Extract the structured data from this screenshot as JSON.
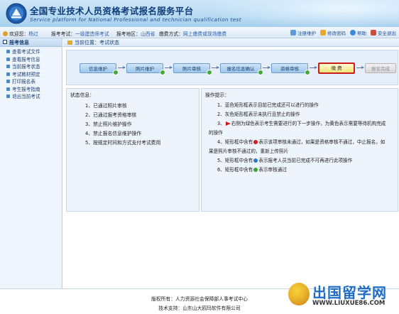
{
  "header": {
    "title": "全国专业技术人员资格考试报名服务平台",
    "subtitle": "Service platform for National Professional and technician qualification test"
  },
  "infobar": {
    "welcome_label": "欢迎您：",
    "welcome_user": "杨过",
    "exam_label": "报考考试：",
    "exam_value": "一级建造师考试",
    "region_label": "报考地区：",
    "region_value": "山西省",
    "fee_label": "缴费方式：",
    "fee_value": "网上缴费或现场缴费",
    "links": [
      "注册维护",
      "修改密码",
      "帮助",
      "安全退出"
    ]
  },
  "sidebar": {
    "title": "报考信息",
    "items": [
      "查看考试文件",
      "查看报考信息",
      "当前报考状态",
      "考试教材预定",
      "打印报名表",
      "考生报考指南",
      "退出当前考试"
    ]
  },
  "main": {
    "location_label": "当前位置：",
    "location_value": "考试状态"
  },
  "steps": [
    {
      "label": "信息维护",
      "state": "blue"
    },
    {
      "label": "照片维护",
      "state": "blue"
    },
    {
      "label": "照片审核",
      "state": "blue"
    },
    {
      "label": "报名信息确认",
      "state": "blue"
    },
    {
      "label": "资格审核",
      "state": "blue"
    },
    {
      "label": "缴 费",
      "state": "current"
    },
    {
      "label": "报名完成",
      "state": "gray"
    }
  ],
  "status_panel": {
    "title": "状态信息：",
    "items": [
      "1、已通过照片审核",
      "2、已通过报考资格审核",
      "3、禁止照片维护操作",
      "4、禁止报名信息维护操作",
      "5、按规定时间和方式支付考试费用"
    ]
  },
  "ops_panel": {
    "title": "操作提示：",
    "items": [
      "1、蓝色矩形框表示目前已完成还可以进行的操作",
      "2、灰色矩形框表示未执行且禁止的操作",
      "3、",
      "右侧为绿色表示考生需要进行的下一步操作，为黄色表示需要等待机构完成",
      "的操作",
      "4、矩形框中含有",
      "表示该项审核未通过，如果是资格审核不通过，中止报名，如",
      "果是照片审核不通过的，重新上传照片",
      "5、矩形框中含有",
      "表示报考人员当前已完成不可再进行此项操作",
      "6、矩形框中含有",
      "表示审核通过"
    ]
  },
  "footer": {
    "copyright": "版权所有：人力资源社会保障部人事考试中心",
    "support": "技术支持：山东山大鸥玛软件有限公司"
  },
  "watermark": {
    "text": "出国留学网",
    "url": "WWW.LIUXUE86.COM"
  },
  "colors": {
    "accent": "#0d3d7a",
    "step_blue": "#9fc6ea",
    "step_current": "#f3e47a",
    "step_current_border": "#cc1c1c",
    "step_done_badge": "#45a93a"
  }
}
